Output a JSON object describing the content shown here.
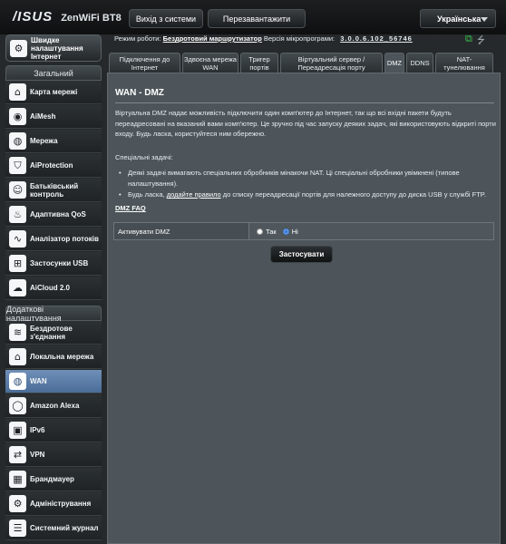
{
  "header": {
    "brand": "/ISUS",
    "model": "ZenWiFi BT8",
    "logout_label": "Вихід з системи",
    "reboot_label": "Перезавантажити",
    "language": "Українська"
  },
  "status": {
    "mode_label": "Режим роботи:",
    "mode_value": "Бездротовий маршрутизатор",
    "fw_label": "Версія мікропрограми:",
    "fw_value": "3.0.0.6.102_56746"
  },
  "sidebar": {
    "quick_label": "Швидке налаштування Інтернет",
    "general_head": "Загальний",
    "general_items": [
      {
        "label": "Карта мережі"
      },
      {
        "label": "AiMesh"
      },
      {
        "label": "Мережа"
      },
      {
        "label": "AiProtection"
      },
      {
        "label": "Батьківський контроль"
      },
      {
        "label": "Адаптивна QoS"
      },
      {
        "label": "Аналізатор потоків"
      },
      {
        "label": "Застосунки USB"
      },
      {
        "label": "AiCloud 2.0"
      }
    ],
    "advanced_head": "Додаткові налаштування",
    "advanced_items": [
      {
        "label": "Бездротове з'єднання"
      },
      {
        "label": "Локальна мережа"
      },
      {
        "label": "WAN"
      },
      {
        "label": "Amazon Alexa"
      },
      {
        "label": "IPv6"
      },
      {
        "label": "VPN"
      },
      {
        "label": "Брандмауер"
      },
      {
        "label": "Адміністрування"
      },
      {
        "label": "Системний журнал"
      }
    ]
  },
  "tabs": [
    {
      "label": "Підключення до Інтернет"
    },
    {
      "label": "Здвоєна мережа WAN"
    },
    {
      "label": "Тригер портів"
    },
    {
      "label": "Віртуальний сервер / Переадресація порту"
    },
    {
      "label": "DMZ"
    },
    {
      "label": "DDNS"
    },
    {
      "label": "NAT-тунелювання"
    }
  ],
  "content": {
    "title": "WAN - DMZ",
    "description": "Віртуальна DMZ надає можливість підключити один комп'ютер до Інтернет, так що всі вхідні пакети будуть переадресовані на вказаний вами комп'ютер. Це зручно під час запуску деяких задач, які використовують відкриті порти входу. Будь ласка, користуйтеся ним обережно.",
    "notes_title": "Спеціальні задачі:",
    "note1": "Деякі задачі вимагають спеціальних обробників мінакочи NAT. Ці спеціальні обробники увімкнені (типове налаштування).",
    "note2_prefix": "Будь ласка, ",
    "note2_link": "додайте правило",
    "note2_suffix": " до списку переадресації портів для належного доступу до диска USB у службі FTP.",
    "faq": "DMZ FAQ",
    "setting_label": "Активувати DMZ",
    "opt_yes": "Так",
    "opt_no": "Ні",
    "apply": "Застосувати"
  }
}
